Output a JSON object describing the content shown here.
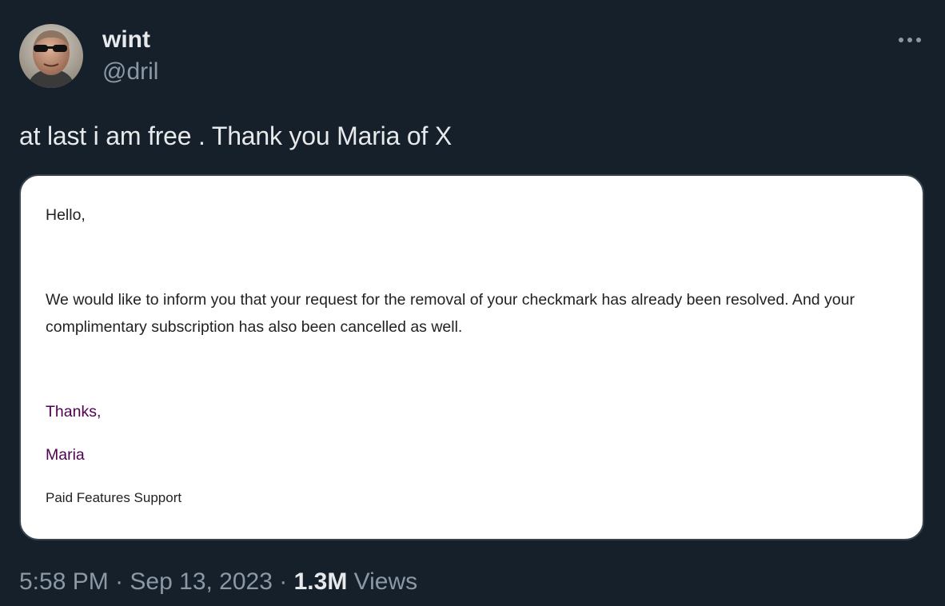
{
  "author": {
    "display_name": "wint",
    "handle": "@dril"
  },
  "tweet": {
    "text": "at last i am free . Thank you Maria of X"
  },
  "email_image": {
    "greeting": "Hello,",
    "body_line_1": "We would like to inform you that your request for the removal of your checkmark has already been resolved. And your",
    "body_line_2": "complimentary subscription has also been cancelled as well.",
    "closing": "Thanks,",
    "signature_name": "Maria",
    "signature_team": "Paid Features Support"
  },
  "meta": {
    "time": "5:58 PM",
    "separator": "·",
    "date": "Sep 13, 2023",
    "views_count": "1.3M",
    "views_label": "Views"
  },
  "icons": {
    "more": "more-horizontal-icon"
  },
  "colors": {
    "background": "#15202b",
    "primary_text": "#e7e9ea",
    "secondary_text": "#8b98a5",
    "card_border": "#38444d",
    "email_text": "#222222",
    "email_signature": "#500050"
  }
}
